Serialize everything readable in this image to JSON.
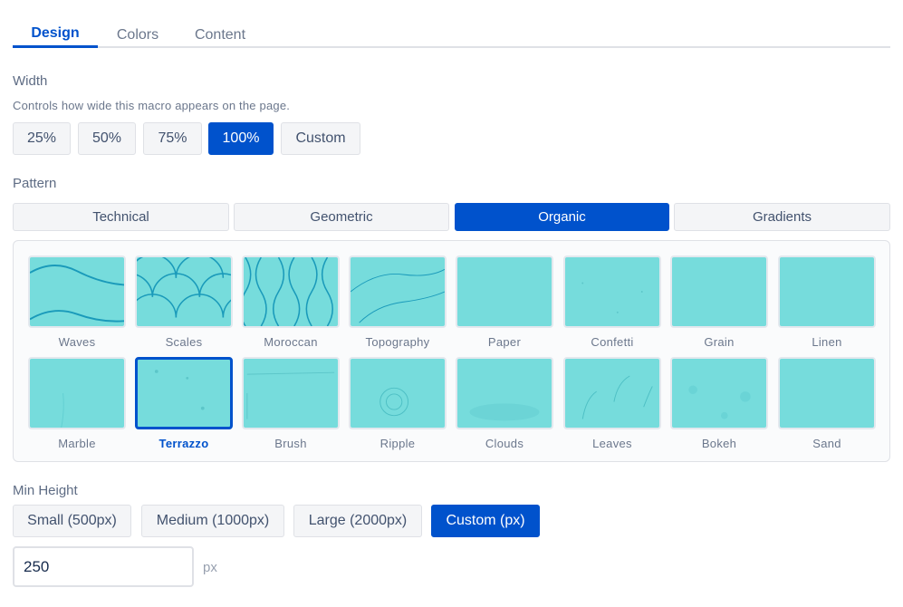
{
  "tabs": [
    {
      "label": "Design",
      "active": true
    },
    {
      "label": "Colors",
      "active": false
    },
    {
      "label": "Content",
      "active": false
    }
  ],
  "width": {
    "label": "Width",
    "help": "Controls how wide this macro appears on the page.",
    "options": [
      "25%",
      "50%",
      "75%",
      "100%",
      "Custom"
    ],
    "selected": "100%"
  },
  "pattern": {
    "label": "Pattern",
    "categories": [
      "Technical",
      "Geometric",
      "Organic",
      "Gradients"
    ],
    "selected_category": "Organic",
    "swatch_color": "#76dcdc",
    "stroke_color": "#1a9aba",
    "items": [
      "Waves",
      "Scales",
      "Moroccan",
      "Topography",
      "Paper",
      "Confetti",
      "Grain",
      "Linen",
      "Marble",
      "Terrazzo",
      "Brush",
      "Ripple",
      "Clouds",
      "Leaves",
      "Bokeh",
      "Sand"
    ],
    "selected_item": "Terrazzo"
  },
  "min_height": {
    "label": "Min Height",
    "options": [
      "Small (500px)",
      "Medium (1000px)",
      "Large (2000px)",
      "Custom (px)"
    ],
    "selected": "Custom (px)",
    "value": "250",
    "unit": "px"
  },
  "colors": {
    "accent": "#0052cc",
    "muted_text": "#6b778c"
  }
}
